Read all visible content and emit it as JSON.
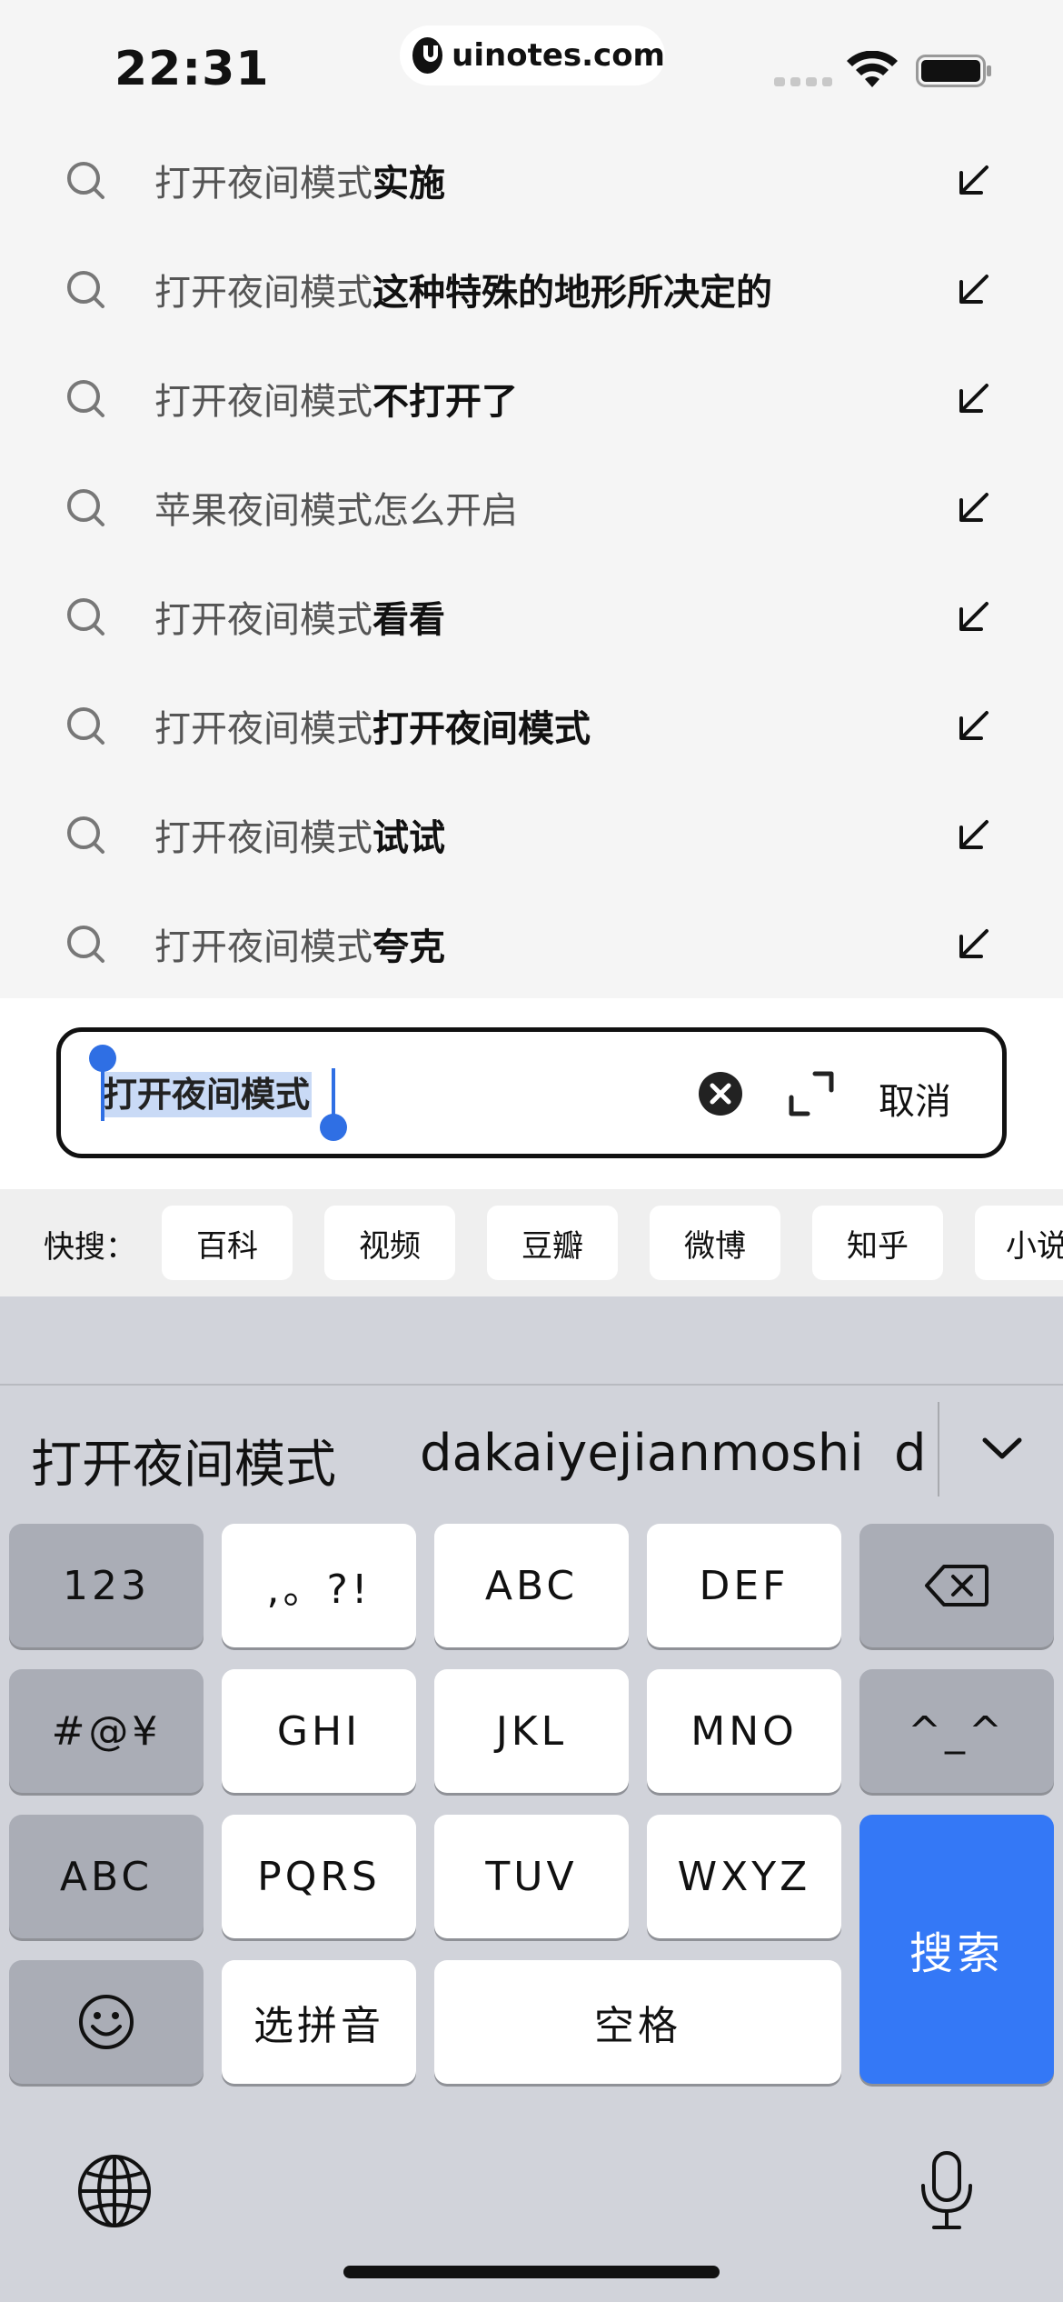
{
  "status_bar": {
    "time": "22:31",
    "watermark": "uinotes.com"
  },
  "suggestions": [
    {
      "prefix": "打开夜间模式",
      "rest": "实施"
    },
    {
      "prefix": "打开夜间模式",
      "rest": "这种特殊的地形所决定的"
    },
    {
      "prefix": "打开夜间模式",
      "rest": "不打开了"
    },
    {
      "prefix": "苹果夜间模式怎么开启",
      "rest": ""
    },
    {
      "prefix": "打开夜间模式",
      "rest": "看看"
    },
    {
      "prefix": "打开夜间模式",
      "rest": "打开夜间模式"
    },
    {
      "prefix": "打开夜间模式",
      "rest": "试试"
    },
    {
      "prefix": "打开夜间模式",
      "rest": "夸克"
    }
  ],
  "search": {
    "query": "打开夜间模式",
    "cancel_label": "取消"
  },
  "quick_search": {
    "label": "快搜：",
    "chips": [
      "百科",
      "视频",
      "豆瓣",
      "微博",
      "知乎",
      "小说"
    ]
  },
  "keyboard": {
    "candidates": [
      "打开夜间模式",
      "dakaiyejianmoshi",
      "d"
    ],
    "rows": {
      "num": "123",
      "punct": ",。?!",
      "abc": "ABC",
      "def": "DEF",
      "symbols": "#@¥",
      "ghi": "GHI",
      "jkl": "JKL",
      "mno": "MNO",
      "emoticon": "^_^",
      "abc_switch": "ABC",
      "pqrs": "PQRS",
      "tuv": "TUV",
      "wxyz": "WXYZ",
      "pinyin": "选拼音",
      "space": "空格",
      "search": "搜索"
    }
  },
  "icons": {
    "suggestion": "search-icon",
    "fill": "arrow-down-left-icon",
    "clear": "clear-icon",
    "expand": "expand-icon",
    "backspace": "backspace-icon",
    "emoji": "emoji-icon",
    "globe": "globe-icon",
    "mic": "microphone-icon"
  },
  "colors": {
    "accent": "#3478f6",
    "selection": "#c9daf6"
  }
}
